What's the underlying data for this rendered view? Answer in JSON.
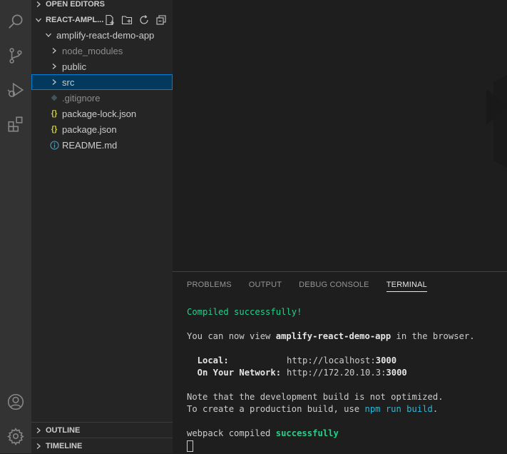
{
  "activity_bar": {
    "items": [
      "search-icon",
      "source-control-icon",
      "run-debug-icon",
      "extensions-icon"
    ],
    "bottom": [
      "account-icon",
      "settings-gear-icon"
    ]
  },
  "sidebar": {
    "open_editors": "OPEN EDITORS",
    "workspace": "REACT-AMPL...",
    "tree": [
      {
        "label": "amplify-react-demo-app",
        "kind": "folder",
        "expanded": true
      },
      {
        "label": "node_modules",
        "kind": "folder"
      },
      {
        "label": "public",
        "kind": "folder"
      },
      {
        "label": "src",
        "kind": "folder",
        "selected": true
      },
      {
        "label": ".gitignore",
        "kind": "file",
        "icon": "git-diamond-icon"
      },
      {
        "label": "package-lock.json",
        "kind": "file",
        "icon": "json-braces-icon",
        "icon_text": "{}"
      },
      {
        "label": "package.json",
        "kind": "file",
        "icon": "json-braces-icon",
        "icon_text": "{}"
      },
      {
        "label": "README.md",
        "kind": "file",
        "icon": "info-icon",
        "icon_text": "i"
      }
    ],
    "outline": "OUTLINE",
    "timeline": "TIMELINE"
  },
  "panel": {
    "tabs": [
      "PROBLEMS",
      "OUTPUT",
      "DEBUG CONSOLE",
      "TERMINAL"
    ],
    "active_tab": "TERMINAL",
    "terminal": {
      "compiled": "Compiled successfully!",
      "view_prefix": "You can now view ",
      "app_name": "amplify-react-demo-app",
      "view_suffix": " in the browser.",
      "local_label": "  Local:",
      "local_url_prefix": "http://localhost:",
      "local_port": "3000",
      "network_label": "  On Your Network:",
      "network_url_prefix": "http://172.20.10.3:",
      "network_port": "3000",
      "note1": "Note that the development build is not optimized.",
      "note2_prefix": "To create a production build, use ",
      "note2_cmd": "npm run build",
      "note2_suffix": ".",
      "webpack_prefix": "webpack compiled ",
      "webpack_status": "successfully"
    }
  },
  "colors": {
    "accent_selection": "#04395e",
    "terminal_green": "#23d18b",
    "terminal_cyan": "#29b8db",
    "json_icon": "#cbcb41",
    "info_icon": "#519aba"
  }
}
